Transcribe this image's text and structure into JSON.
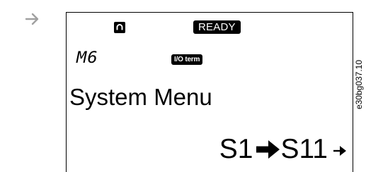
{
  "figure_code": "e30bg037.10",
  "pointer": {
    "icon": "arrow-right-icon",
    "color": "#a0a0a0"
  },
  "display": {
    "status_icon": "keypad-control-icon",
    "status_badge": "READY",
    "menu_code": "M6",
    "control_badge": "I/O term",
    "menu_title": "System Menu",
    "nav": {
      "current": "S1",
      "arrow_icon": "arrow-right-bold-icon",
      "target": "S11",
      "more_icon": "arrow-right-small-icon"
    }
  }
}
